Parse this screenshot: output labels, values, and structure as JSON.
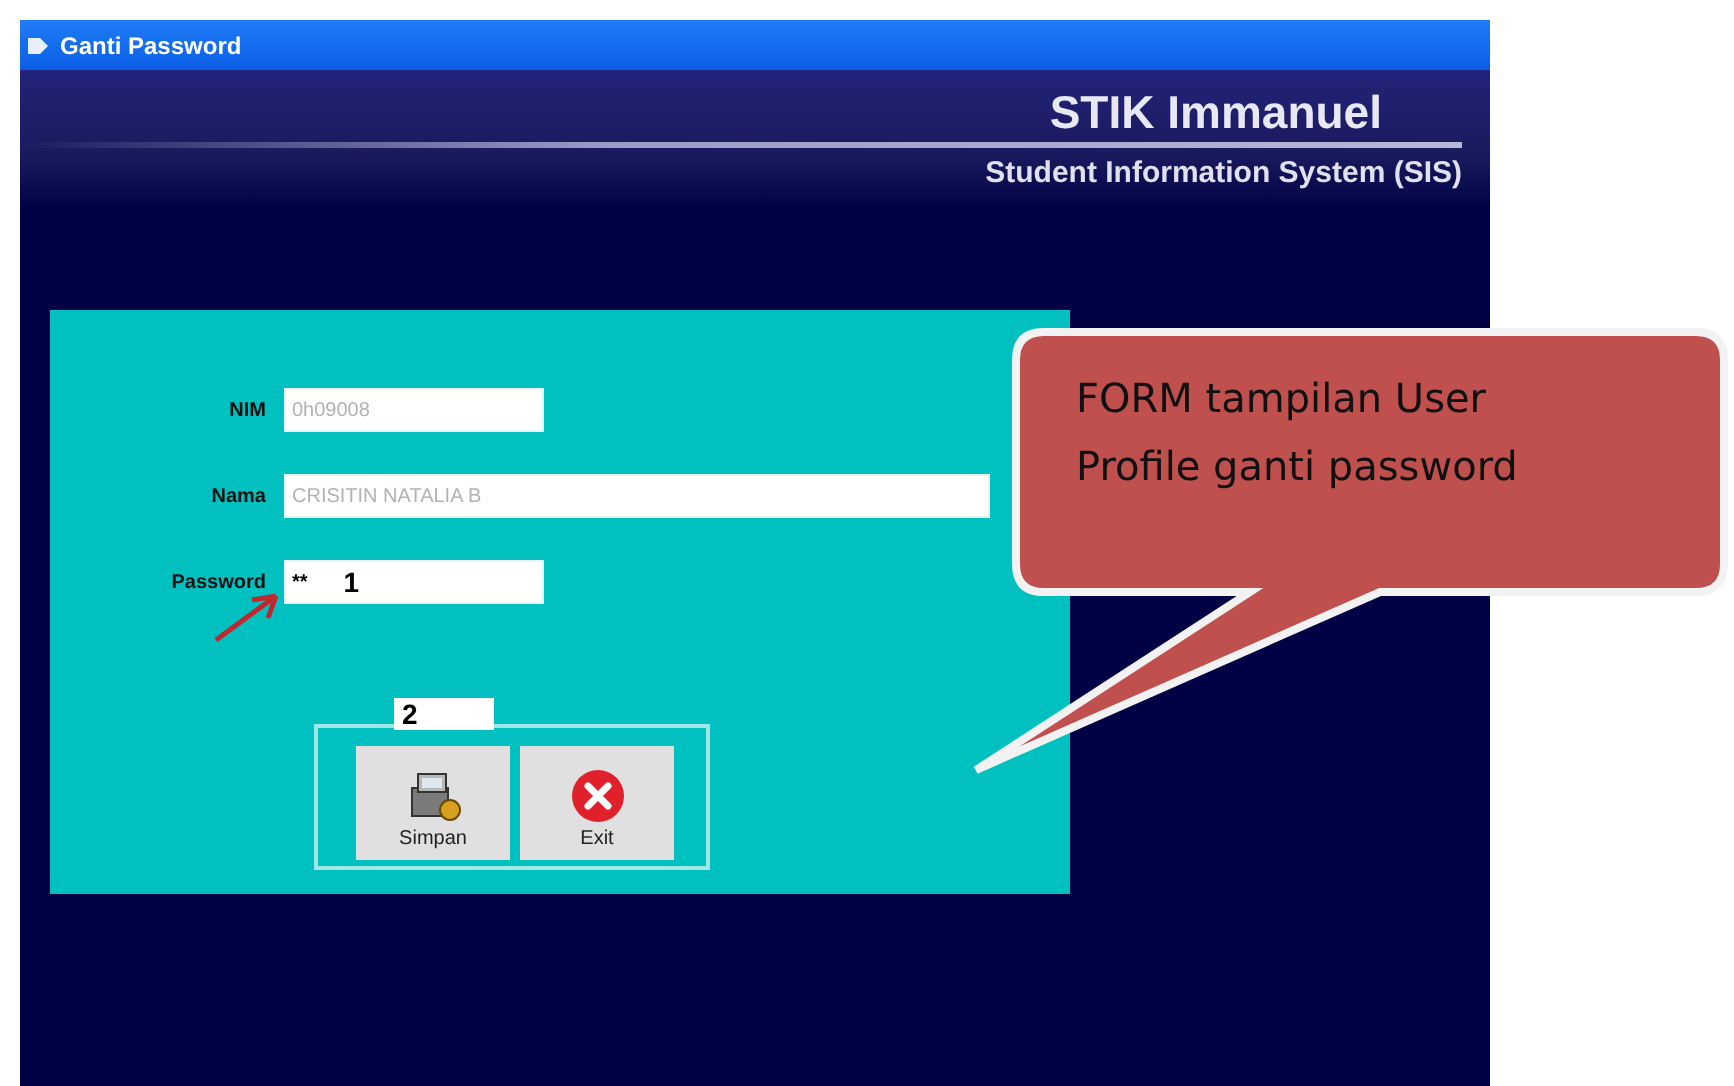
{
  "window": {
    "title": "Ganti Password"
  },
  "header": {
    "title": "STIK Immanuel",
    "subtitle": "Student Information System (SIS)"
  },
  "form": {
    "fields": [
      {
        "label": "NIM",
        "value": "0h09008",
        "disabled": true,
        "kind": "narrow"
      },
      {
        "label": "Nama",
        "value": "CRISITIN NATALIA B",
        "disabled": true,
        "kind": "wide"
      },
      {
        "label": "Password",
        "value": "**",
        "disabled": false,
        "kind": "narrow",
        "marker": "1"
      }
    ],
    "buttons": [
      {
        "label": "Simpan",
        "kind": "save"
      },
      {
        "label": "Exit",
        "kind": "exit"
      }
    ]
  },
  "annotations": {
    "button_marker": "2",
    "callout": "FORM tampilan User Profile ganti password"
  }
}
